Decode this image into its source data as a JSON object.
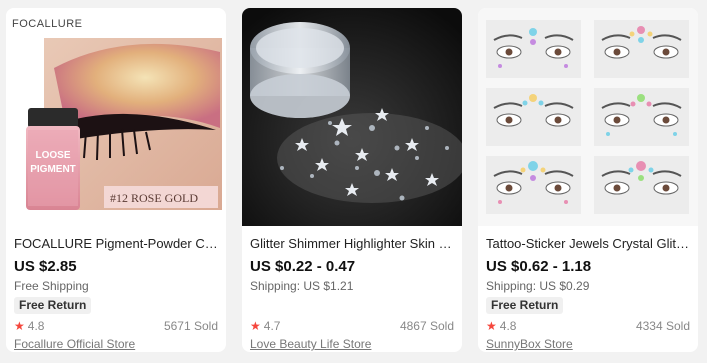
{
  "colors": {
    "rating_star": "#f5463c",
    "card_bg": "#ffffff",
    "page_bg": "#f2f2f2"
  },
  "products": [
    {
      "image_overlay": {
        "brand": "FOCALLURE",
        "shade": "#12 ROSE GOLD",
        "jar_label_1": "LOOSE",
        "jar_label_2": "PIGMENT"
      },
      "title": "FOCALLURE Pigment-Powder Cos...",
      "price": "US $2.85",
      "shipping": "Free Shipping",
      "badge": "Free Return",
      "rating": "4.8",
      "sold": "5671 Sold",
      "store": "Focallure Official Store",
      "rating_icon": "star-icon"
    },
    {
      "title": "Glitter Shimmer Highlighter Skin F...",
      "price": "US $0.22 - 0.47",
      "shipping": "Shipping: US $1.21",
      "rating": "4.7",
      "sold": "4867 Sold",
      "store": "Love Beauty Life Store",
      "rating_icon": "star-icon"
    },
    {
      "title": "Tattoo-Sticker Jewels Crystal Glitte...",
      "price": "US $0.62 - 1.18",
      "shipping": "Shipping: US $0.29",
      "badge": "Free Return",
      "rating": "4.8",
      "sold": "4334 Sold",
      "store": "SunnyBox Store",
      "rating_icon": "star-icon"
    }
  ]
}
